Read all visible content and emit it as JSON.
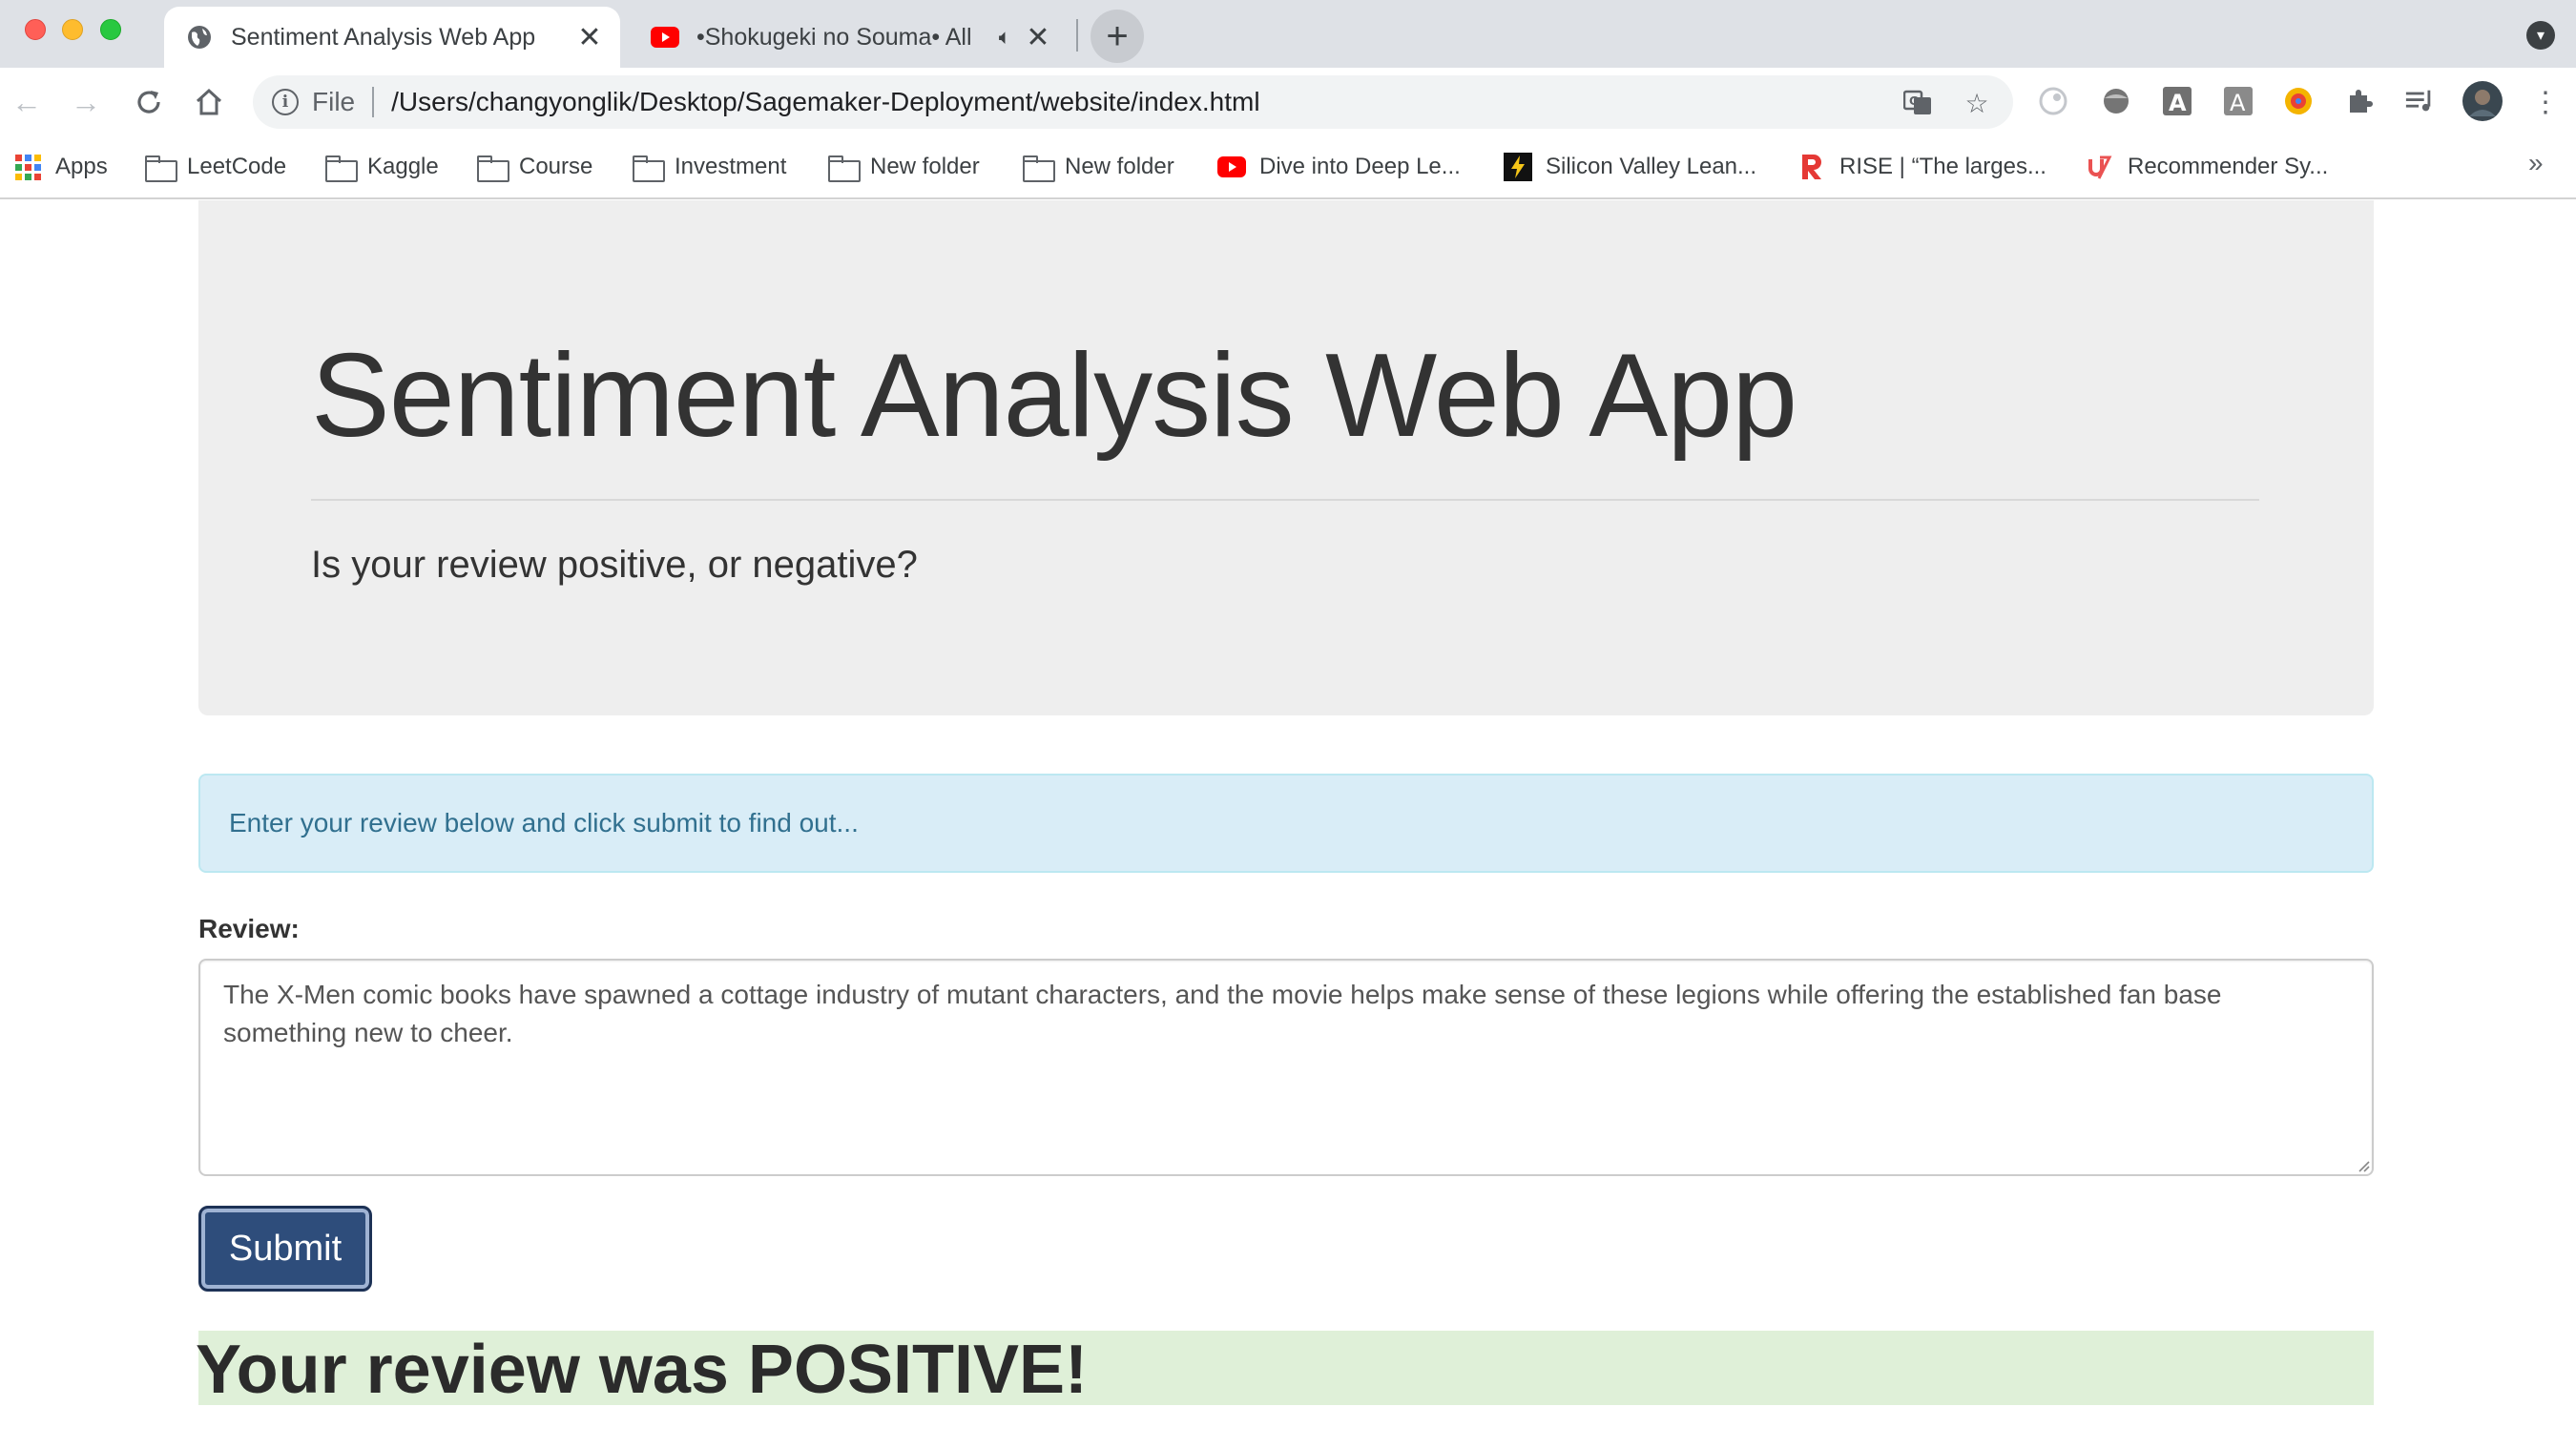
{
  "browser": {
    "tabs": [
      {
        "title": "Sentiment Analysis Web App",
        "active": true
      },
      {
        "title": "•Shokugeki no Souma• All",
        "active": false
      }
    ],
    "address_bar": {
      "scheme_label": "File",
      "url": "/Users/changyonglik/Desktop/Sagemaker-Deployment/website/index.html"
    },
    "bookmarks": [
      {
        "label": "Apps",
        "icon": "apps-grid-icon"
      },
      {
        "label": "LeetCode",
        "icon": "folder-icon"
      },
      {
        "label": "Kaggle",
        "icon": "folder-icon"
      },
      {
        "label": "Course",
        "icon": "folder-icon"
      },
      {
        "label": "Investment",
        "icon": "folder-icon"
      },
      {
        "label": "New folder",
        "icon": "folder-icon"
      },
      {
        "label": "New folder",
        "icon": "folder-icon"
      },
      {
        "label": "Dive into Deep Le...",
        "icon": "youtube-icon"
      },
      {
        "label": "Silicon Valley Lean...",
        "icon": "lightning-icon"
      },
      {
        "label": "RISE | “The larges...",
        "icon": "rise-logo-icon"
      },
      {
        "label": "Recommender Sy...",
        "icon": "udemy-icon"
      }
    ],
    "overflow_label": "»"
  },
  "page": {
    "heading": "Sentiment Analysis Web App",
    "subheading": "Is your review positive, or negative?",
    "info_alert": "Enter your review below and click submit to find out...",
    "review_label": "Review:",
    "review_text": "The X-Men comic books have spawned a cottage industry of mutant characters, and the movie helps make sense of these legions while offering the established fan base something new to cheer.",
    "submit_label": "Submit",
    "result": "Your review was POSITIVE!"
  },
  "colors": {
    "jumbotron_bg": "#eeeeee",
    "alert_info_bg": "#d9edf7",
    "alert_info_text": "#31708f",
    "submit_bg": "#2e4d7b",
    "result_bg": "#dff0d8"
  }
}
